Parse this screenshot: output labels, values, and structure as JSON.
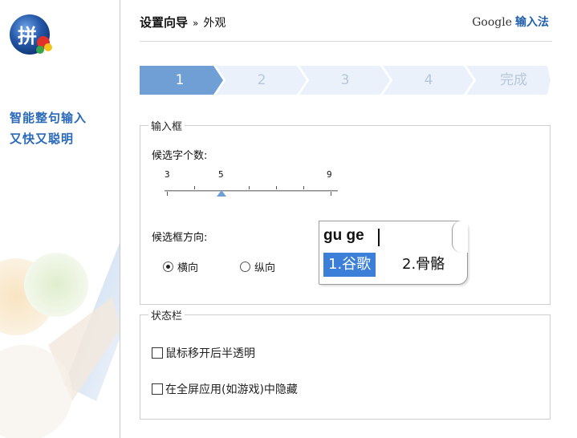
{
  "sidebar": {
    "slogan_line1": "智能整句输入",
    "slogan_line2": "又快又聪明"
  },
  "header": {
    "title": "设置向导",
    "separator": "»",
    "subtitle": "外观",
    "brand_google": "Google",
    "brand_ime": "输入法"
  },
  "steps": [
    {
      "label": "1",
      "active": true
    },
    {
      "label": "2",
      "active": false
    },
    {
      "label": "3",
      "active": false
    },
    {
      "label": "4",
      "active": false
    },
    {
      "label": "完成",
      "active": false
    }
  ],
  "input_box": {
    "legend": "输入框",
    "candidate_count_label": "候选字个数:",
    "slider": {
      "min": "3",
      "mid": "5",
      "max": "9",
      "value": 5
    },
    "direction_label": "候选框方向:",
    "direction_options": [
      {
        "label": "横向",
        "selected": true
      },
      {
        "label": "纵向",
        "selected": false
      }
    ],
    "preview": {
      "pinyin": "gu ge",
      "candidate1": "1.谷歌",
      "candidate2": "2.骨骼"
    }
  },
  "status_bar": {
    "legend": "状态栏",
    "option1": "鼠标移开后半透明",
    "option2": "在全屏应用(如游戏)中隐藏"
  },
  "colors": {
    "accent_blue": "#2a6ab9",
    "step_active": "#6f9fd4",
    "step_inactive": "#eaf1fa",
    "candidate_highlight": "#3b7fd8"
  }
}
